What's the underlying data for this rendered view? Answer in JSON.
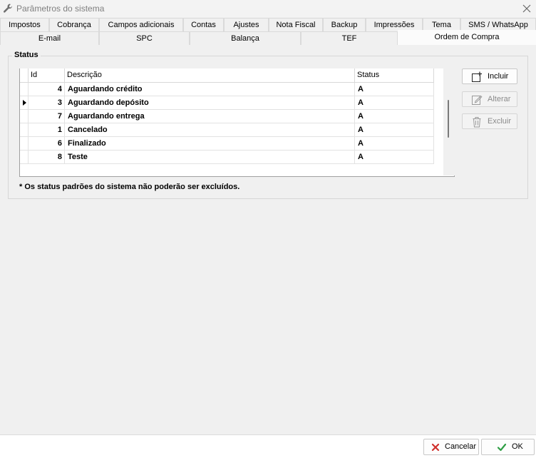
{
  "window": {
    "title": "Parâmetros do sistema"
  },
  "tabs_row1": [
    {
      "label": "Impostos"
    },
    {
      "label": "Cobrança"
    },
    {
      "label": "Campos adicionais"
    },
    {
      "label": "Contas"
    },
    {
      "label": "Ajustes"
    },
    {
      "label": "Nota Fiscal"
    },
    {
      "label": "Backup"
    },
    {
      "label": "Impressões"
    },
    {
      "label": "Tema"
    },
    {
      "label": "SMS / WhatsApp"
    }
  ],
  "tabs_row2": [
    {
      "label": "E-mail"
    },
    {
      "label": "SPC"
    },
    {
      "label": "Balança"
    },
    {
      "label": "TEF"
    },
    {
      "label": "Ordem de Compra"
    }
  ],
  "active_tab": "Ordem de Compra",
  "group": {
    "legend": "Status"
  },
  "grid": {
    "columns": [
      "Id",
      "Descrição",
      "Status"
    ],
    "selected_row": 1,
    "rows": [
      {
        "id": "4",
        "descricao": "Aguardando crédito",
        "status": "A"
      },
      {
        "id": "3",
        "descricao": "Aguardando depósito",
        "status": "A"
      },
      {
        "id": "7",
        "descricao": "Aguardando entrega",
        "status": "A"
      },
      {
        "id": "1",
        "descricao": "Cancelado",
        "status": "A"
      },
      {
        "id": "6",
        "descricao": "Finalizado",
        "status": "A"
      },
      {
        "id": "8",
        "descricao": "Teste",
        "status": "A"
      }
    ]
  },
  "buttons": {
    "incluir": "Incluir",
    "alterar": "Alterar",
    "excluir": "Excluir"
  },
  "note": "* Os status padrões do sistema não poderão ser excluídos.",
  "footer": {
    "cancel": "Cancelar",
    "ok": "OK"
  },
  "icons": {
    "window": "wrench-icon",
    "close": "close-icon",
    "incluir": "add-document-icon",
    "alterar": "edit-icon",
    "excluir": "trash-icon",
    "cancel": "red-x-icon",
    "ok": "green-check-icon"
  },
  "colors": {
    "cancel_icon": "#d0312d",
    "ok_icon": "#2e9e44"
  }
}
